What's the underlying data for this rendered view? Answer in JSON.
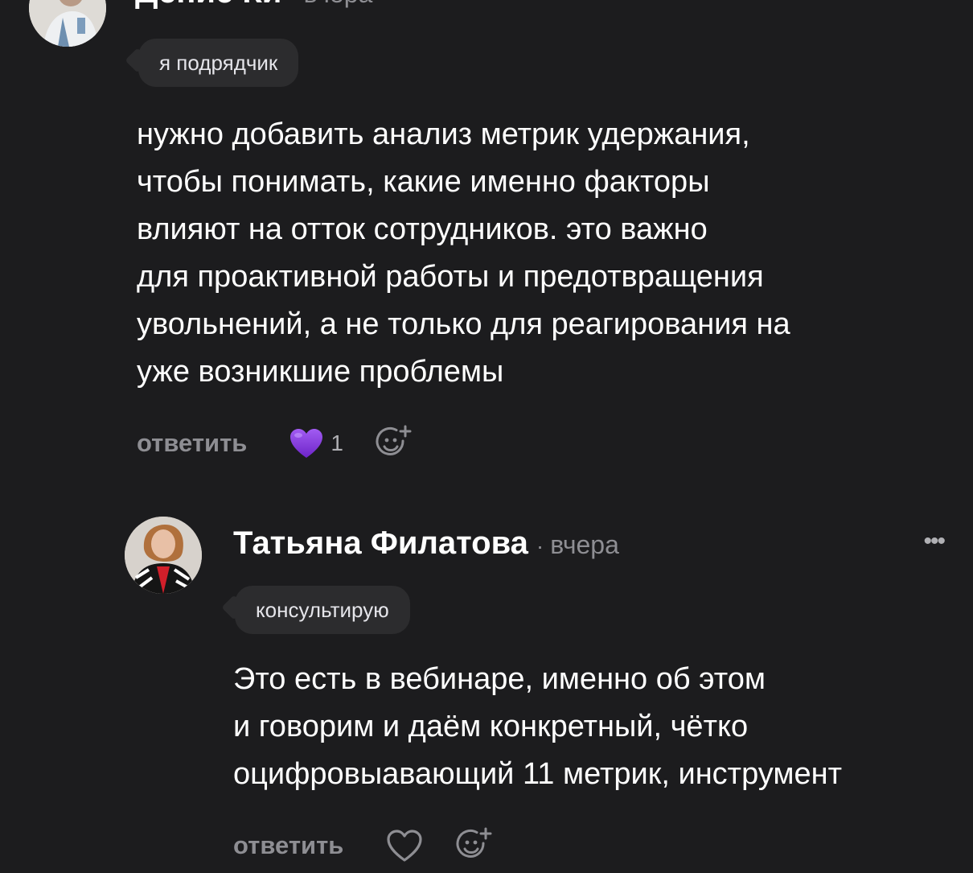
{
  "comments": [
    {
      "author": "Денис Ки",
      "time": "вчера",
      "badge": "я подрядчик",
      "text": "нужно добавить анализ метрик удержания,\nчтобы понимать, какие именно факторы\nвлияют на отток сотрудников. это важно\nдля проактивной работы и предотвращения\nувольнений, а не только для реагирования на\nуже возникшие проблемы",
      "reply_label": "ответить",
      "likes": "1",
      "liked": true,
      "more": "•••"
    },
    {
      "author": "Татьяна Филатова",
      "time": "вчера",
      "badge": "консультирую",
      "text": "Это есть в вебинаре, именно об этом\nи говорим и даём конкретный, чётко\nоцифровыавающий 11 метрик, инструмент",
      "reply_label": "ответить",
      "liked": false,
      "more": "•••"
    }
  ],
  "separator": "·",
  "colors": {
    "background": "#1c1c1e",
    "badge_bg": "#2c2c2e",
    "muted_text": "#8e8e93",
    "heart_liked": "#8b3fe0"
  },
  "icons": {
    "like": "heart-icon",
    "react": "add-reaction-icon",
    "more": "more-options-icon"
  }
}
